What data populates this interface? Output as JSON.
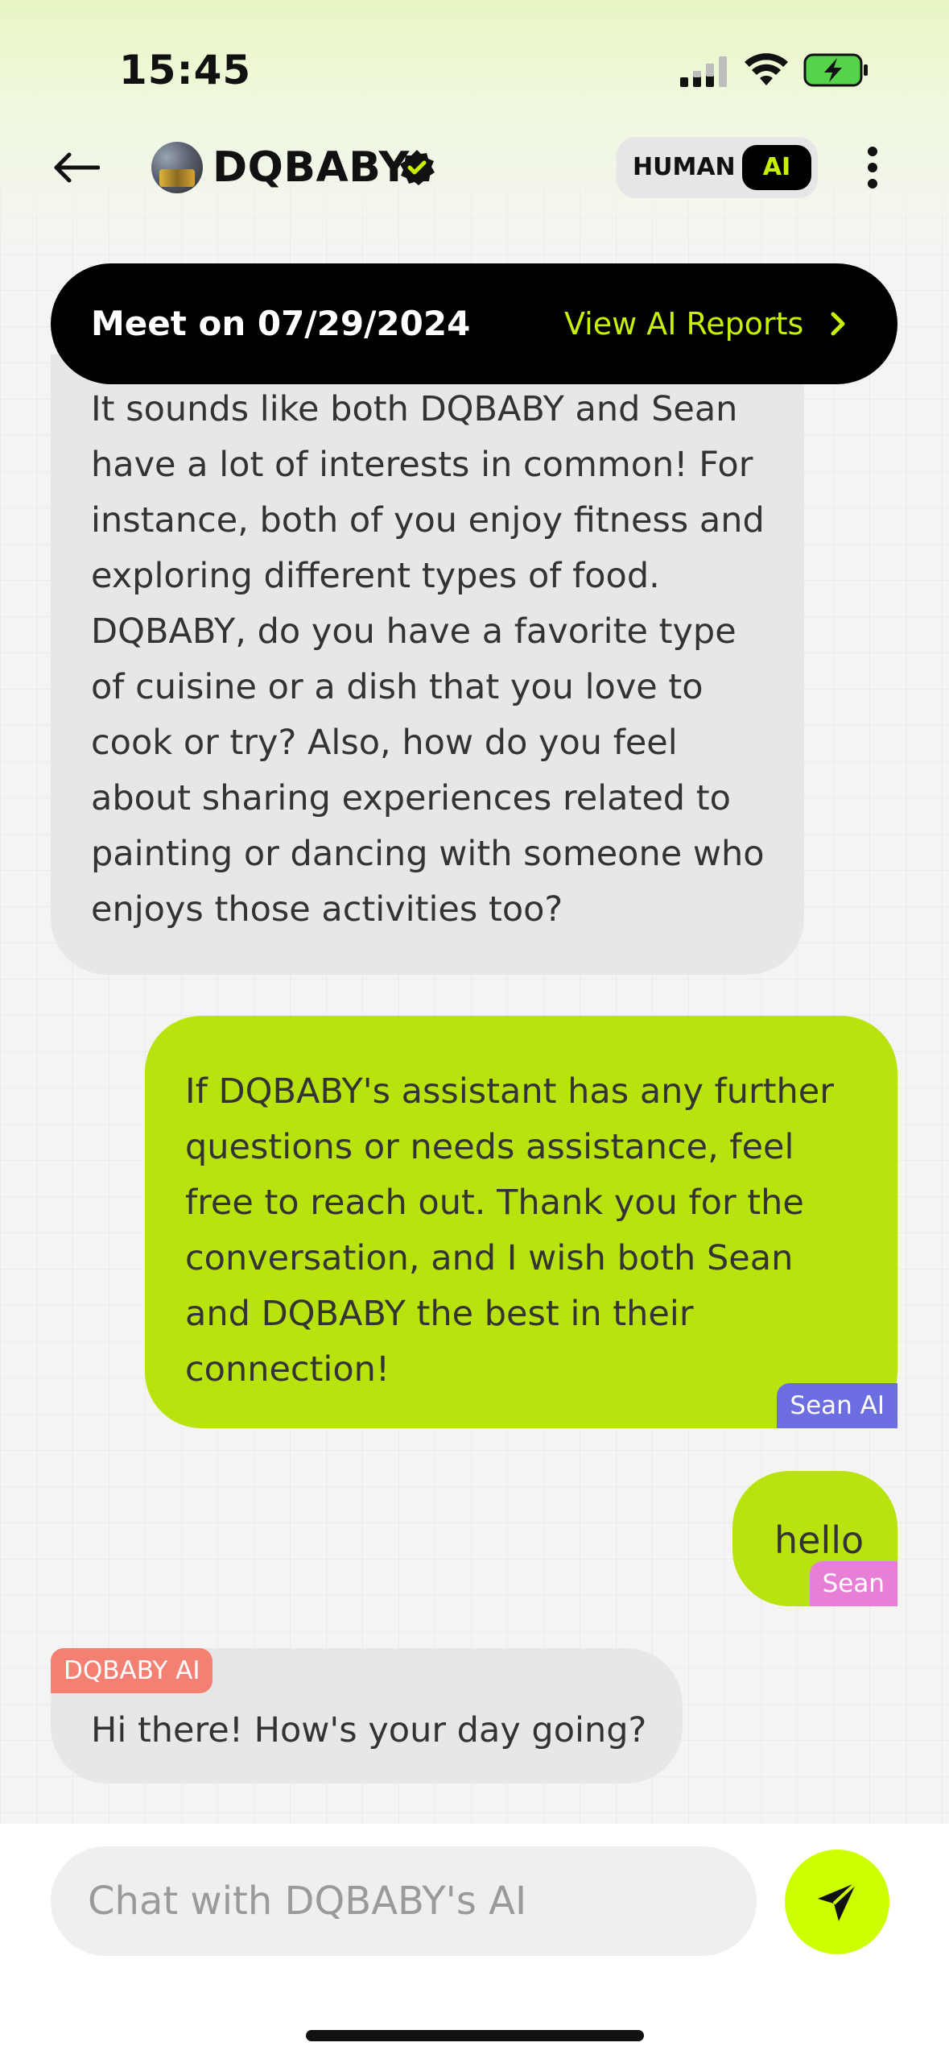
{
  "status_bar": {
    "time": "15:45"
  },
  "header": {
    "name": "DQBABY",
    "mode_human": "HUMAN",
    "mode_ai": "AI"
  },
  "banner": {
    "meet_label": "Meet on 07/29/2024",
    "view_reports": "View AI Reports"
  },
  "messages": [
    {
      "text": "It sounds like both DQBABY and Sean have a lot of interests in common! For instance, both of you enjoy fitness and exploring different types of food. DQBABY, do you have a favorite type of cuisine or a dish that you love to cook or try? Also, how do you feel about sharing experiences related to painting or dancing with someone who enjoys those activities too?"
    },
    {
      "text": "If DQBABY's assistant has any further questions or needs assistance, feel free to reach out. Thank you for the conversation, and I wish both Sean and DQBABY the best in their connection!",
      "sender": "Sean AI"
    },
    {
      "text": "hello",
      "sender": "Sean"
    },
    {
      "text": "Hi there! How's your day going?",
      "sender": "DQBABY AI"
    }
  ],
  "input": {
    "placeholder": "Chat with DQBABY's AI",
    "value": ""
  },
  "colors": {
    "accent_lime": "#ccff00",
    "bubble_green": "#b8e30f",
    "bubble_gray": "#e7e7e7",
    "tag_sean_ai": "#6c6de0",
    "tag_sean": "#e97ed6",
    "tag_dqbaby_ai": "#f47f73"
  }
}
